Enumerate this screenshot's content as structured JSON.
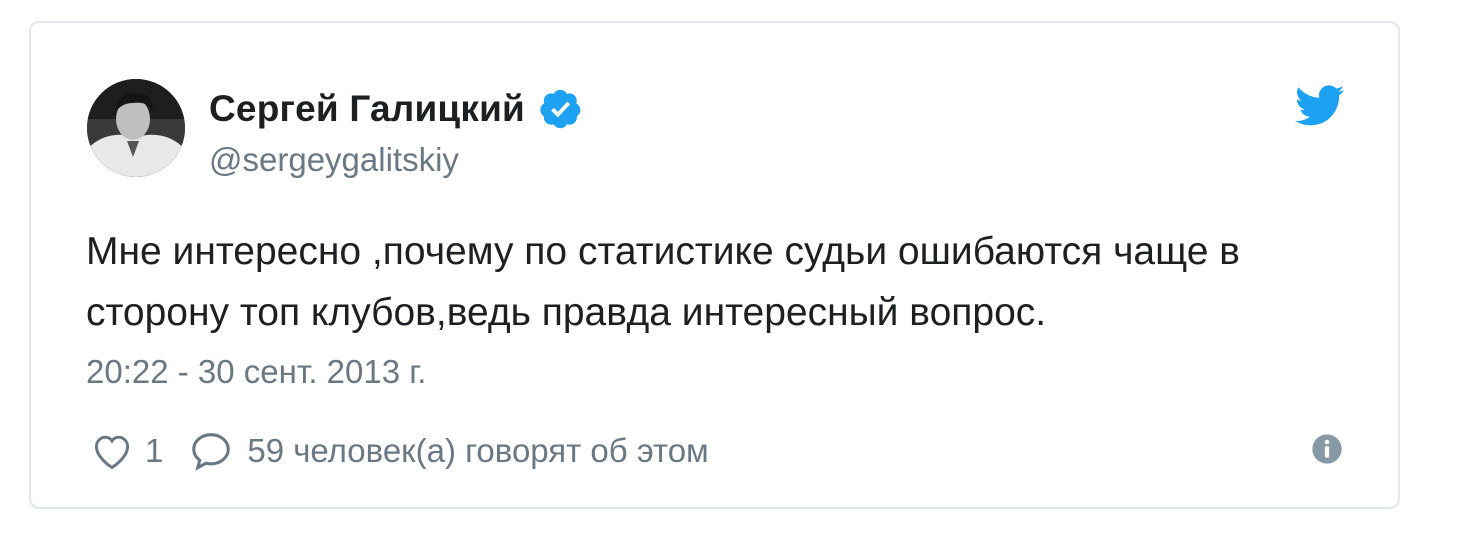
{
  "tweet": {
    "display_name": "Сергей Галицкий",
    "handle": "@sergeygalitskiy",
    "verified_icon": "verified-badge-icon",
    "brand_icon": "twitter-bird-icon",
    "text": "Мне интересно ,почему по статистике судьи ошибаются чаще в сторону топ клубов,ведь правда интересный вопрос.",
    "timestamp": "20:22 - 30 сент. 2013 г.",
    "likes": "1",
    "replies_text": "59 человек(а) говорят об этом"
  },
  "icons": {
    "like": "heart-icon",
    "reply": "comment-icon",
    "info": "info-icon"
  },
  "colors": {
    "twitter_blue": "#1da1f2",
    "text_primary": "#1c2022",
    "text_secondary": "#697882",
    "border": "#e1e8ed"
  }
}
